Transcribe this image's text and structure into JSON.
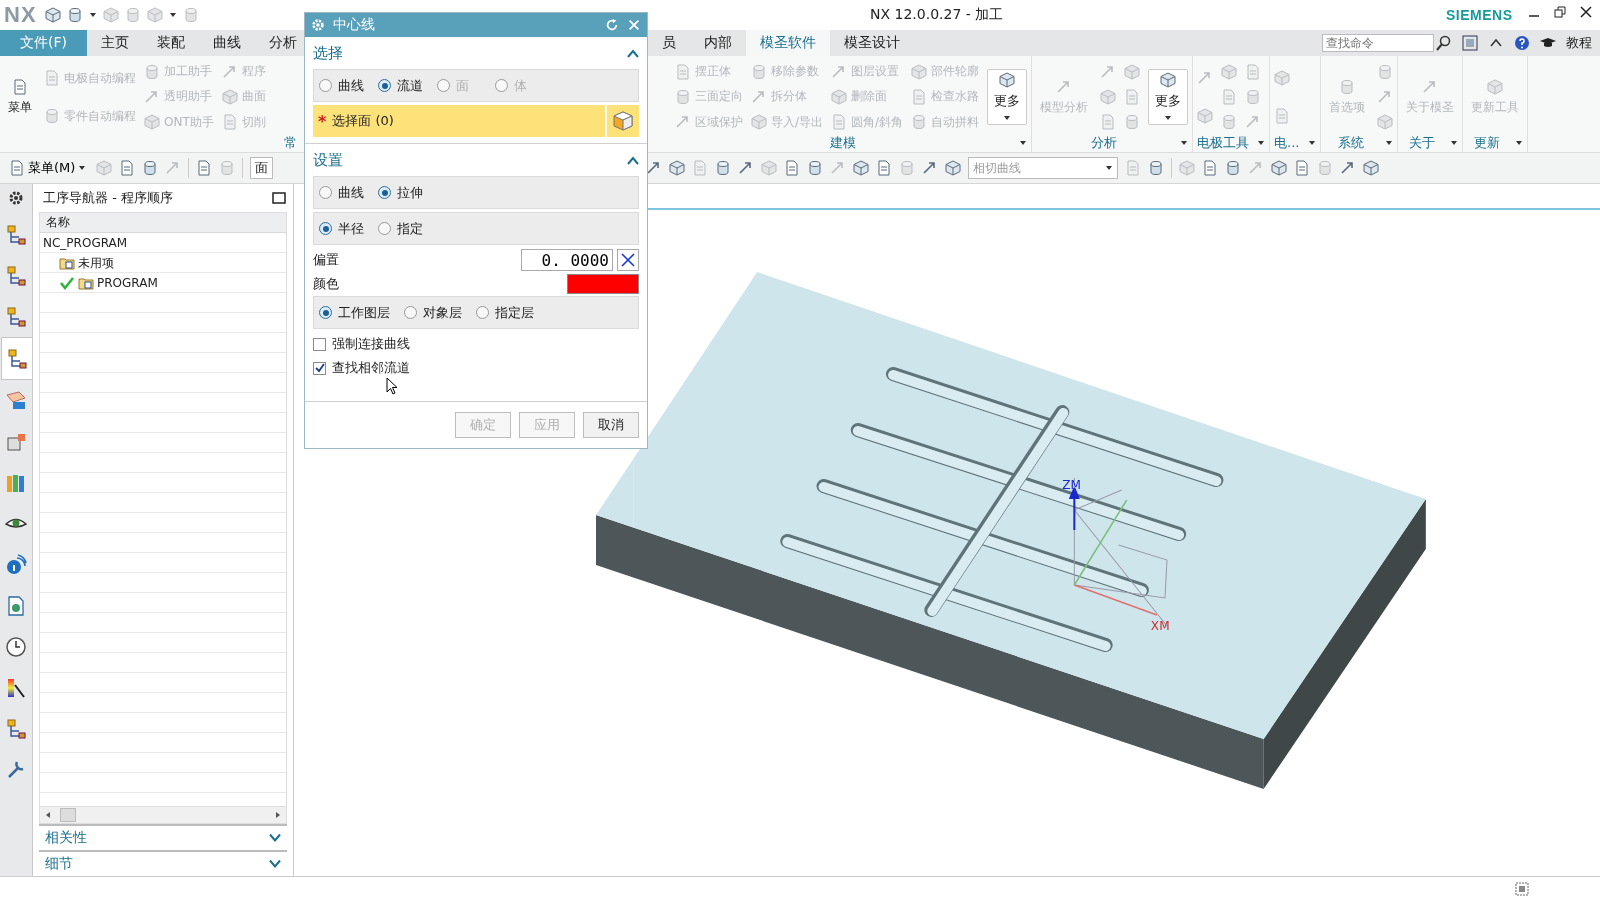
{
  "window": {
    "logo": "NX",
    "title": "NX 12.0.0.27 - 加工",
    "brand": "SIEMENS"
  },
  "tabs": [
    {
      "label": "文件(F)",
      "kind": "file",
      "selected": false
    },
    {
      "label": "主页",
      "kind": "tab",
      "selected": false
    },
    {
      "label": "装配",
      "kind": "tab",
      "selected": false
    },
    {
      "label": "曲线",
      "kind": "tab",
      "selected": false
    },
    {
      "label": "分析",
      "kind": "tab",
      "selected": false
    },
    {
      "label": "员",
      "kind": "tab",
      "selected": false
    },
    {
      "label": "内部",
      "kind": "tab",
      "selected": false
    },
    {
      "label": "模圣软件",
      "kind": "tab",
      "selected": true
    },
    {
      "label": "模圣设计",
      "kind": "tab",
      "selected": false
    }
  ],
  "search": {
    "placeholder": "查找命令"
  },
  "tutorial": "教程",
  "ribbon": [
    {
      "label": "常",
      "dropdown": false,
      "columns": [
        [
          {
            "kind": "large",
            "label": "菜单",
            "disabled": false
          }
        ],
        [
          {
            "kind": "small",
            "label": "电极自动编程",
            "disabled": true
          },
          {
            "kind": "small",
            "label": "零件自动编程",
            "disabled": true
          }
        ],
        [
          {
            "kind": "small",
            "label": "加工助手",
            "disabled": true
          },
          {
            "kind": "small",
            "label": "透明助手",
            "disabled": true
          },
          {
            "kind": "small",
            "label": "ONT助手",
            "disabled": true
          }
        ],
        [
          {
            "kind": "small",
            "label": "程序",
            "disabled": true
          },
          {
            "kind": "small",
            "label": "曲面",
            "disabled": true
          },
          {
            "kind": "small",
            "label": "切削",
            "disabled": true
          }
        ]
      ]
    },
    {
      "label": "建模",
      "columns": [
        [
          {
            "kind": "small",
            "label": "摆正体",
            "disabled": true
          },
          {
            "kind": "small",
            "label": "三面定向",
            "disabled": true
          },
          {
            "kind": "small",
            "label": "区域保护",
            "disabled": true
          }
        ],
        [
          {
            "kind": "small",
            "label": "移除参数",
            "disabled": true
          },
          {
            "kind": "small",
            "label": "拆分体",
            "disabled": true
          },
          {
            "kind": "small",
            "label": "导入/导出",
            "disabled": true
          }
        ],
        [
          {
            "kind": "small",
            "label": "图层设置",
            "disabled": true
          },
          {
            "kind": "small",
            "label": "删除面",
            "disabled": true
          },
          {
            "kind": "small",
            "label": "圆角/斜角",
            "disabled": true
          }
        ],
        [
          {
            "kind": "small",
            "label": "部件轮廓",
            "disabled": true
          },
          {
            "kind": "small",
            "label": "检查水路",
            "disabled": true
          },
          {
            "kind": "small",
            "label": "自动拼料",
            "disabled": true
          }
        ],
        [
          {
            "kind": "more",
            "label": "更多",
            "disabled": false
          }
        ]
      ]
    },
    {
      "label": "分析",
      "columns": [
        [
          {
            "kind": "large",
            "label": "模型分析",
            "disabled": true
          }
        ],
        [
          {
            "kind": "icon"
          },
          {
            "kind": "icon"
          },
          {
            "kind": "icon"
          }
        ],
        [
          {
            "kind": "icon"
          },
          {
            "kind": "icon"
          },
          {
            "kind": "icon"
          }
        ],
        [
          {
            "kind": "more",
            "label": "更多",
            "disabled": false
          }
        ]
      ]
    },
    {
      "label": "电极工具",
      "columns": [
        [
          {
            "kind": "icon"
          },
          {
            "kind": "icon"
          }
        ],
        [
          {
            "kind": "icon"
          },
          {
            "kind": "icon"
          },
          {
            "kind": "icon"
          }
        ],
        [
          {
            "kind": "icon"
          },
          {
            "kind": "icon"
          },
          {
            "kind": "icon"
          }
        ]
      ]
    },
    {
      "label": "电...",
      "columns": [
        [
          {
            "kind": "icon"
          },
          {
            "kind": "icon"
          }
        ]
      ]
    },
    {
      "label": "系统",
      "columns": [
        [
          {
            "kind": "large",
            "label": "首选项",
            "disabled": true
          }
        ],
        [
          {
            "kind": "icon"
          },
          {
            "kind": "icon"
          },
          {
            "kind": "icon"
          }
        ]
      ]
    },
    {
      "label": "关于",
      "columns": [
        [
          {
            "kind": "large",
            "label": "关于模圣",
            "disabled": true
          }
        ]
      ]
    },
    {
      "label": "更新",
      "columns": [
        [
          {
            "kind": "large",
            "label": "更新工具",
            "disabled": true
          }
        ]
      ]
    }
  ],
  "toolbar": {
    "menu_label": "菜单(M)",
    "left": [
      {
        "kind": "icon"
      },
      {
        "kind": "icon"
      },
      {
        "kind": "icon"
      },
      {
        "kind": "icon"
      },
      {
        "kind": "sep"
      },
      {
        "kind": "icon"
      },
      {
        "kind": "icon"
      },
      {
        "kind": "sep"
      }
    ],
    "filter_value": "面",
    "right": [
      {
        "kind": "icon"
      },
      {
        "kind": "icon"
      },
      {
        "kind": "icon"
      },
      {
        "kind": "icon"
      },
      {
        "kind": "icon"
      },
      {
        "kind": "icon"
      },
      {
        "kind": "icon"
      },
      {
        "kind": "icon"
      },
      {
        "kind": "icon"
      },
      {
        "kind": "icon"
      },
      {
        "kind": "icon"
      },
      {
        "kind": "icon"
      },
      {
        "kind": "icon"
      },
      {
        "kind": "icon"
      },
      {
        "kind": "icon"
      }
    ],
    "curve_value": "相切曲线",
    "right2": [
      {
        "kind": "icon"
      },
      {
        "kind": "icon"
      },
      {
        "kind": "sep"
      },
      {
        "kind": "icon"
      },
      {
        "kind": "icon"
      },
      {
        "kind": "icon"
      },
      {
        "kind": "icon"
      },
      {
        "kind": "icon"
      },
      {
        "kind": "icon"
      },
      {
        "kind": "icon"
      },
      {
        "kind": "icon"
      },
      {
        "kind": "icon"
      }
    ]
  },
  "rail": [
    {
      "selected": false
    },
    {
      "selected": false
    },
    {
      "selected": false
    },
    {
      "selected": true
    },
    {
      "selected": false
    },
    {
      "selected": false
    },
    {
      "selected": false
    },
    {
      "selected": false
    },
    {
      "selected": false
    },
    {
      "selected": false
    },
    {
      "selected": false
    },
    {
      "selected": false
    },
    {
      "selected": false
    },
    {
      "selected": false
    }
  ],
  "navigator": {
    "title": "工序导航器 - 程序顺序",
    "column": "名称",
    "tree": [
      {
        "label": "NC_PROGRAM",
        "children": [
          {
            "label": "未用项",
            "complete": false,
            "folder": true
          },
          {
            "label": "PROGRAM",
            "complete": true,
            "folder": true
          }
        ]
      }
    ],
    "sections": [
      {
        "label": "相关性",
        "expanded": false
      },
      {
        "label": "细节",
        "expanded": false
      }
    ]
  },
  "viewport": {
    "axis_labels": [
      "ZM",
      "XM"
    ]
  },
  "dialog": {
    "title": "中心线",
    "selection": {
      "title": "选择",
      "expanded": true,
      "options": [
        {
          "label": "曲线",
          "selected": false,
          "disabled": false
        },
        {
          "label": "流道",
          "selected": true,
          "disabled": false
        },
        {
          "label": "面",
          "selected": false,
          "disabled": true
        },
        {
          "label": "体",
          "selected": false,
          "disabled": true
        }
      ],
      "select_face": {
        "mark": "*",
        "label": "选择面 (0)"
      }
    },
    "settings": {
      "title": "设置",
      "expanded": true,
      "mode_options": [
        {
          "label": "曲线",
          "selected": false,
          "disabled": false
        },
        {
          "label": "拉伸",
          "selected": true,
          "disabled": false
        }
      ],
      "size_options": [
        {
          "label": "半径",
          "selected": true,
          "disabled": false
        },
        {
          "label": "指定",
          "selected": false,
          "disabled": false
        }
      ],
      "offset": {
        "label": "偏置",
        "value": "0. 0000"
      },
      "color": {
        "label": "颜色",
        "color": "#ff0000"
      },
      "layer_options": [
        {
          "label": "工作图层",
          "selected": true,
          "disabled": false
        },
        {
          "label": "对象层",
          "selected": false,
          "disabled": false
        },
        {
          "label": "指定层",
          "selected": false,
          "disabled": false
        }
      ],
      "checkboxes": [
        {
          "label": "强制连接曲线",
          "checked": false
        },
        {
          "label": "查找相邻流道",
          "checked": true
        }
      ]
    },
    "buttons": [
      {
        "label": "确定",
        "disabled": true
      },
      {
        "label": "应用",
        "disabled": true
      },
      {
        "label": "取消",
        "disabled": false
      }
    ]
  }
}
